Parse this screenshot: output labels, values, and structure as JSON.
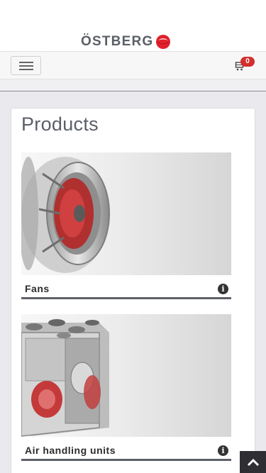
{
  "brand": {
    "name": "ÖSTBERG",
    "logo_color": "#e0202a"
  },
  "nav": {
    "menu_icon": "hamburger-icon",
    "cart_icon": "cart-icon",
    "cart_count": "0"
  },
  "main": {
    "title": "Products"
  },
  "products": [
    {
      "name": "Fans",
      "info_icon": "info-icon"
    },
    {
      "name": "Air handling units",
      "info_icon": "info-icon"
    }
  ],
  "scroll_top": {
    "icon": "chevron-up-icon"
  }
}
